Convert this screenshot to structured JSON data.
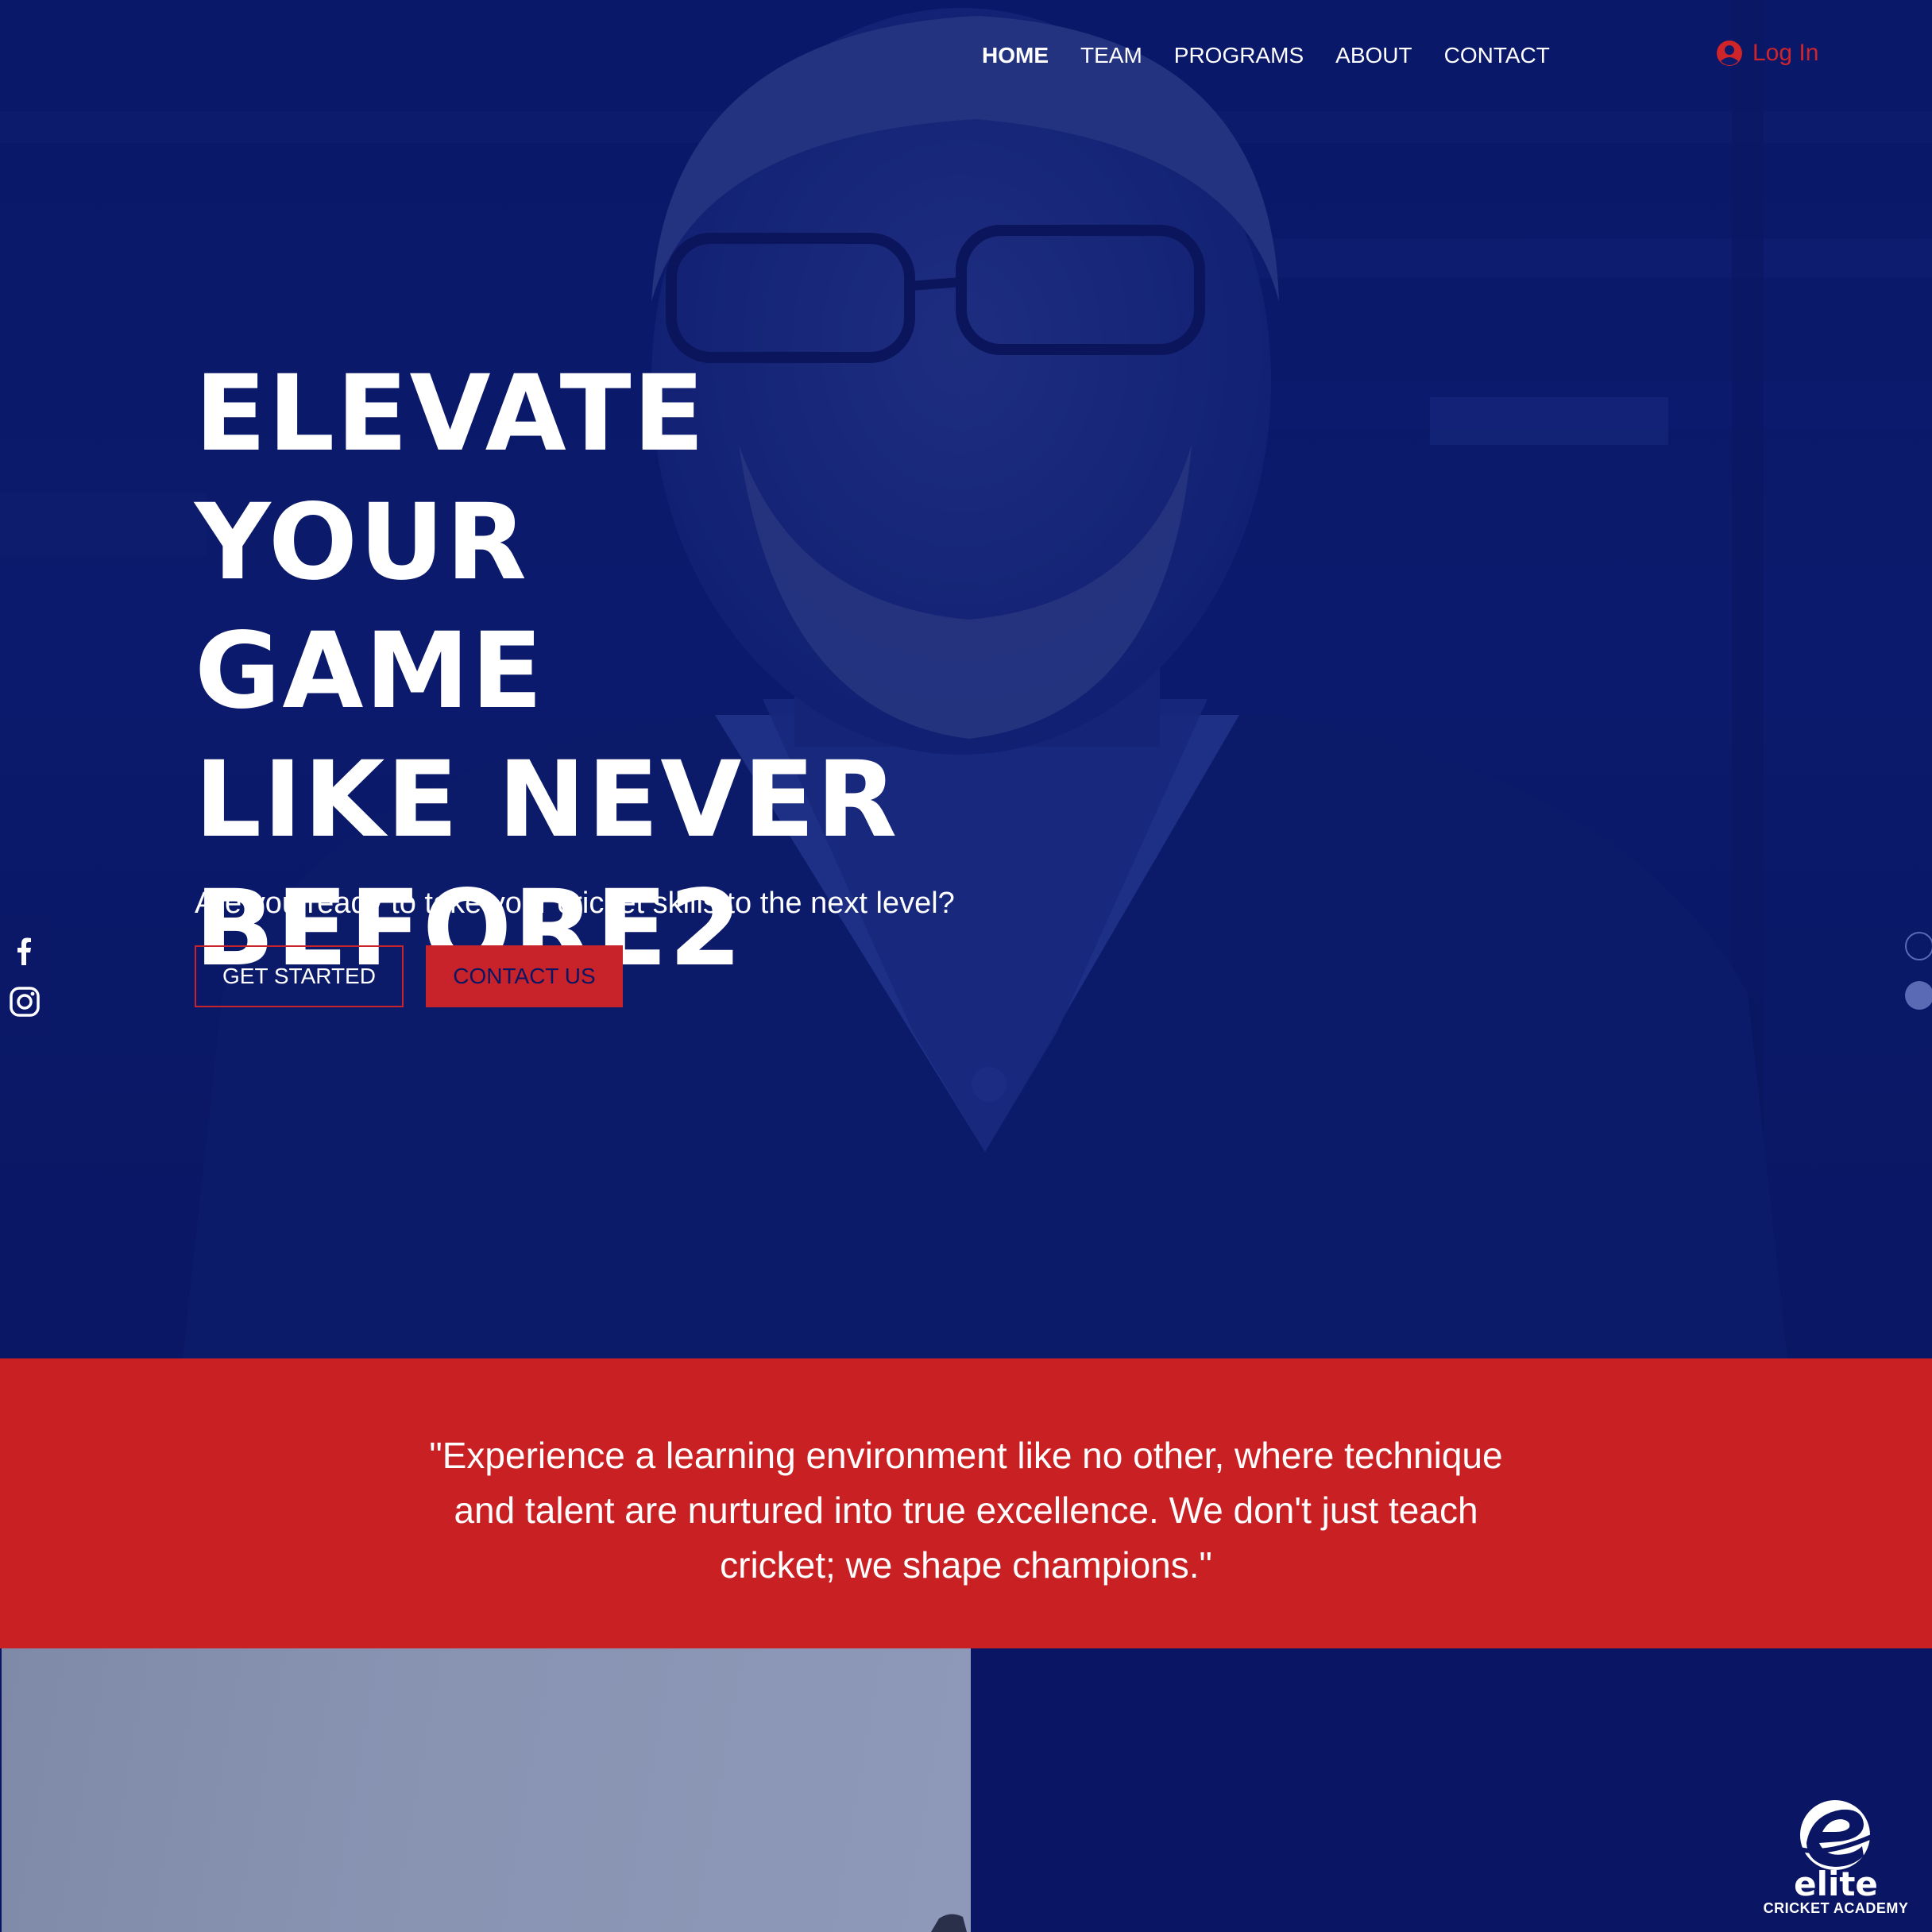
{
  "nav": {
    "items": [
      {
        "label": "HOME",
        "active": true
      },
      {
        "label": "TEAM",
        "active": false
      },
      {
        "label": "PROGRAMS",
        "active": false
      },
      {
        "label": "ABOUT",
        "active": false
      },
      {
        "label": "CONTACT",
        "active": false
      }
    ],
    "login_label": "Log In",
    "login_icon": "user-circle-icon"
  },
  "hero": {
    "headline_lines": [
      "ELEVATE",
      "YOUR GAME",
      "LIKE NEVER",
      "BEFORE2"
    ],
    "subtitle": "Are you ready to take your cricket skills to the next level?",
    "primary_button": "GET STARTED",
    "secondary_button": "CONTACT US"
  },
  "social": {
    "icons": [
      "facebook-icon",
      "instagram-icon"
    ]
  },
  "quote": {
    "text": "\"Experience a learning environment like no other, where technique and talent are nurtured into true excellence. We don't just teach cricket; we shape champions.\""
  },
  "logo": {
    "word": "elite",
    "subtitle": "CRICKET ACADEMY"
  },
  "colors": {
    "navy": "#0a1664",
    "red": "#c92024",
    "white": "#ffffff"
  }
}
